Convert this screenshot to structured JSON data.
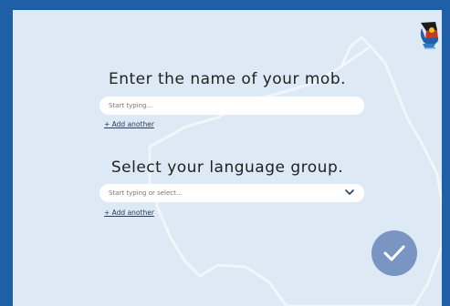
{
  "prompts": {
    "mob_heading": "Enter the name of your mob.",
    "language_heading": "Select your language group."
  },
  "fields": {
    "mob_placeholder": "Start typing...",
    "language_placeholder": "Start typing or select..."
  },
  "links": {
    "add_another_mob": "+ Add another",
    "add_another_language": "+ Add another"
  },
  "colors": {
    "frame": "#1f5fa8",
    "panel": "#dde9f4",
    "confirm_button": "#7a95c2"
  },
  "icons": {
    "logo": "aboriginal-flag-logo",
    "dropdown": "chevron-down-icon",
    "confirm": "checkmark-icon"
  }
}
